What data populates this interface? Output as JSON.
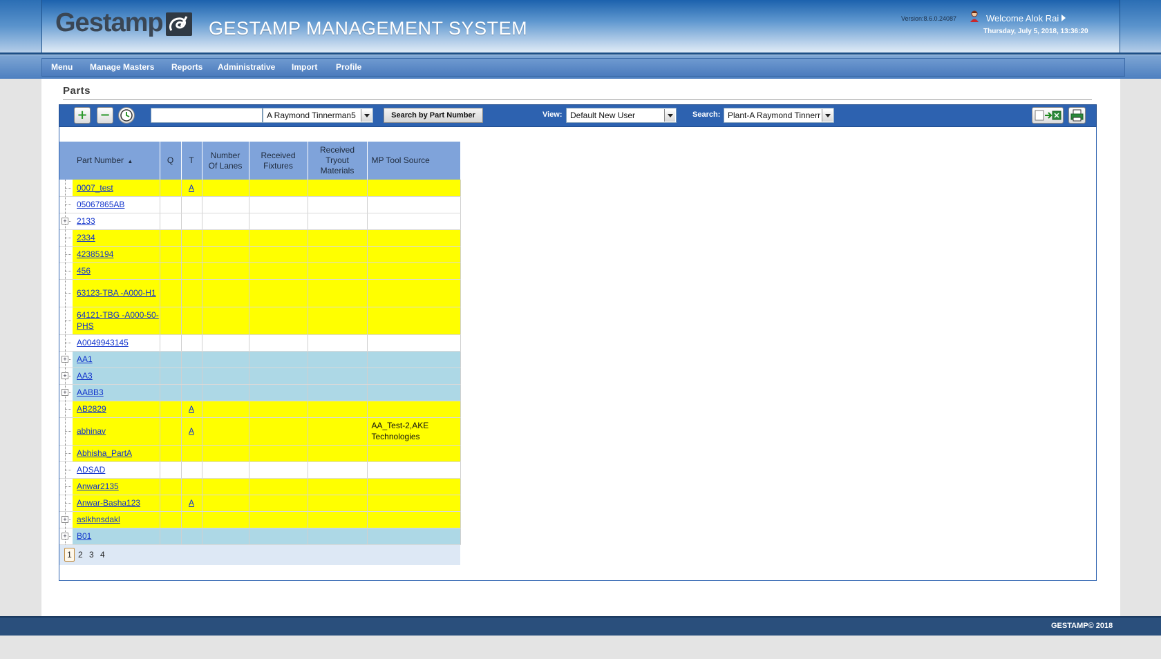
{
  "header": {
    "logo": "Gestamp",
    "app_title": "GESTAMP MANAGEMENT SYSTEM",
    "version": "Version:8.6.0.24087",
    "welcome": "Welcome Alok Rai",
    "datetime": "Thursday, July 5, 2018, 13:36:20"
  },
  "nav": {
    "items": [
      "Menu",
      "Manage Masters",
      "Reports",
      "Administrative",
      "Import",
      "Profile"
    ]
  },
  "page": {
    "title": "Parts"
  },
  "toolbar": {
    "add_icon": "plus-icon",
    "remove_icon": "minus-icon",
    "history_icon": "clock-icon",
    "search_value": "",
    "plant_select": "A Raymond Tinnerman5",
    "search_button": "Search by Part Number",
    "view_label": "View:",
    "view_value": "Default New User",
    "search_label": "Search:",
    "search_select": "Plant-A Raymond Tinnerr",
    "export_icon": "export-excel-icon",
    "print_icon": "print-icon"
  },
  "grid": {
    "columns": {
      "part_number": "Part Number",
      "q": "Q",
      "t": "T",
      "lanes_1": "Number",
      "lanes_2": "Of Lanes",
      "fixtures_1": "Received",
      "fixtures_2": "Fixtures",
      "tryout_1": "Received",
      "tryout_2": "Tryout",
      "tryout_3": "Materials",
      "source": "MP Tool Source"
    },
    "rows": [
      {
        "part": "0007_test",
        "t": "A",
        "source": "",
        "color": "yellow",
        "expand": false
      },
      {
        "part": "05067865AB",
        "t": "",
        "source": "",
        "color": "white",
        "expand": false
      },
      {
        "part": "2133",
        "t": "",
        "source": "",
        "color": "white",
        "expand": true
      },
      {
        "part": "2334",
        "t": "",
        "source": "",
        "color": "yellow",
        "expand": false
      },
      {
        "part": "42385194",
        "t": "",
        "source": "",
        "color": "yellow",
        "expand": false
      },
      {
        "part": "456",
        "t": "",
        "source": "",
        "color": "yellow",
        "expand": false
      },
      {
        "part": "63123-TBA -A000-H1",
        "t": "",
        "source": "",
        "color": "yellow",
        "expand": false
      },
      {
        "part": "64121-TBG -A000-50-PHS",
        "t": "",
        "source": "",
        "color": "yellow",
        "expand": false
      },
      {
        "part": "A0049943145",
        "t": "",
        "source": "",
        "color": "white",
        "expand": false
      },
      {
        "part": "AA1",
        "t": "",
        "source": "",
        "color": "blue",
        "expand": true
      },
      {
        "part": "AA3",
        "t": "",
        "source": "",
        "color": "blue",
        "expand": true
      },
      {
        "part": "AABB3",
        "t": "",
        "source": "",
        "color": "blue",
        "expand": true
      },
      {
        "part": "AB2829",
        "t": "A",
        "source": "",
        "color": "yellow",
        "expand": false
      },
      {
        "part": "abhinav",
        "t": "A",
        "source": "AA_Test-2,AKE Technologies",
        "color": "yellow",
        "expand": false
      },
      {
        "part": "Abhisha_PartA",
        "t": "",
        "source": "",
        "color": "yellow",
        "expand": false
      },
      {
        "part": "ADSAD",
        "t": "",
        "source": "",
        "color": "white",
        "expand": false
      },
      {
        "part": "Anwar2135",
        "t": "",
        "source": "",
        "color": "yellow",
        "expand": false
      },
      {
        "part": "Anwar-Basha123",
        "t": "A",
        "source": "",
        "color": "yellow",
        "expand": false
      },
      {
        "part": "aslkhnsdakl",
        "t": "",
        "source": "",
        "color": "yellow",
        "expand": true
      },
      {
        "part": "B01",
        "t": "",
        "source": "",
        "color": "blue",
        "expand": true
      }
    ]
  },
  "pager": {
    "pages": [
      "1",
      "2",
      "3",
      "4"
    ],
    "current": "1"
  },
  "footer": {
    "text": "GESTAMP© 2018"
  },
  "colors": {
    "yellow": "#ffff00",
    "blue": "#add8e6",
    "toolbar": "#2d62b0",
    "header": "#2b6eb4"
  }
}
